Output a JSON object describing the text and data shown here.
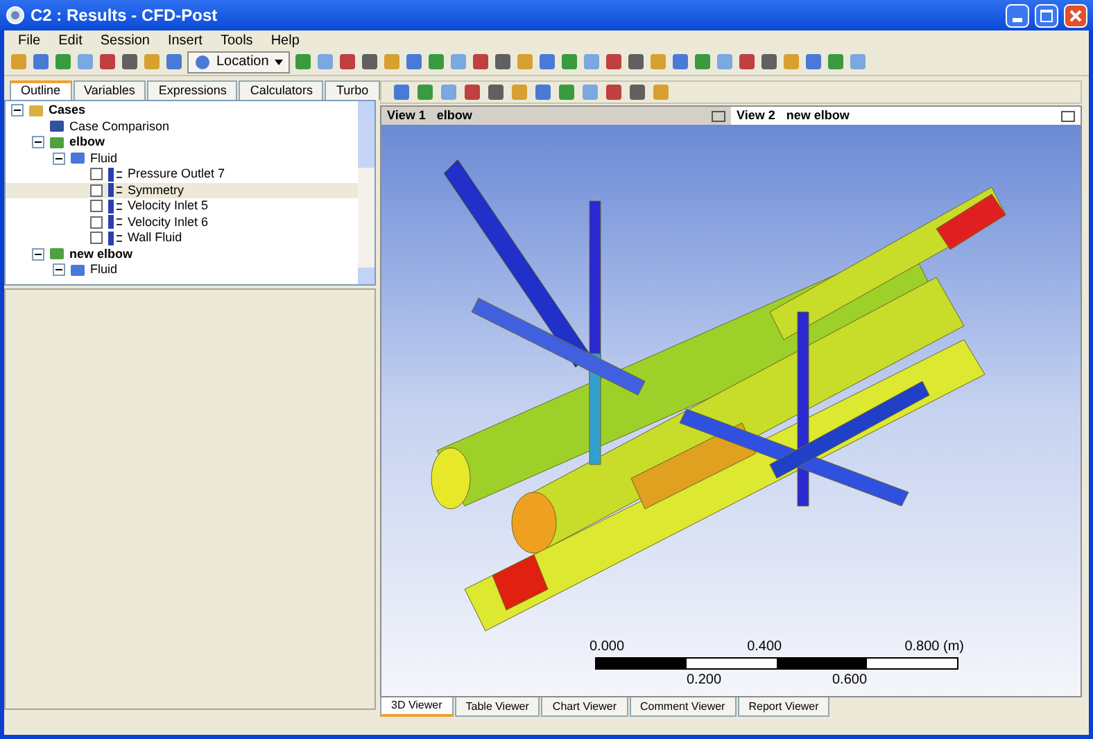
{
  "window": {
    "title": "C2 : Results - CFD-Post"
  },
  "menu": [
    "File",
    "Edit",
    "Session",
    "Insert",
    "Tools",
    "Help"
  ],
  "toolbar": {
    "location_button": "Location"
  },
  "left_tabs": [
    {
      "label": "Outline",
      "selected": true
    },
    {
      "label": "Variables",
      "selected": false
    },
    {
      "label": "Expressions",
      "selected": false
    },
    {
      "label": "Calculators",
      "selected": false
    },
    {
      "label": "Turbo",
      "selected": false
    }
  ],
  "tree": [
    {
      "label": "Cases",
      "kind": "root",
      "expanded": true,
      "selected": false,
      "children": [
        {
          "label": "Case Comparison",
          "kind": "comparison",
          "selected": false
        },
        {
          "label": "elbow",
          "kind": "case",
          "expanded": true,
          "selected": false,
          "children": [
            {
              "label": "Fluid",
              "kind": "domain",
              "expanded": true,
              "selected": false,
              "children": [
                {
                  "label": "Pressure Outlet 7",
                  "kind": "region",
                  "checked": false,
                  "selected": false
                },
                {
                  "label": "Symmetry",
                  "kind": "region",
                  "checked": false,
                  "selected": true
                },
                {
                  "label": "Velocity Inlet 5",
                  "kind": "region",
                  "checked": false,
                  "selected": false
                },
                {
                  "label": "Velocity Inlet 6",
                  "kind": "region",
                  "checked": false,
                  "selected": false
                },
                {
                  "label": "Wall Fluid",
                  "kind": "region",
                  "checked": false,
                  "selected": false
                }
              ]
            }
          ]
        },
        {
          "label": "new elbow",
          "kind": "case",
          "expanded": true,
          "selected": false,
          "children": [
            {
              "label": "Fluid",
              "kind": "domain",
              "expanded": true,
              "selected": false
            }
          ]
        }
      ]
    }
  ],
  "views": [
    {
      "view": "View 1",
      "case": "elbow",
      "selected": true
    },
    {
      "view": "View 2",
      "case": "new elbow",
      "selected": false
    }
  ],
  "scale_bar": {
    "top_labels": [
      "0.000",
      "0.400",
      "0.800 (m)"
    ],
    "bottom_labels": [
      "0.200",
      "0.600"
    ]
  },
  "viewer_tabs": [
    {
      "label": "3D Viewer",
      "selected": true
    },
    {
      "label": "Table Viewer",
      "selected": false
    },
    {
      "label": "Chart Viewer",
      "selected": false
    },
    {
      "label": "Comment Viewer",
      "selected": false
    },
    {
      "label": "Report Viewer",
      "selected": false
    }
  ]
}
